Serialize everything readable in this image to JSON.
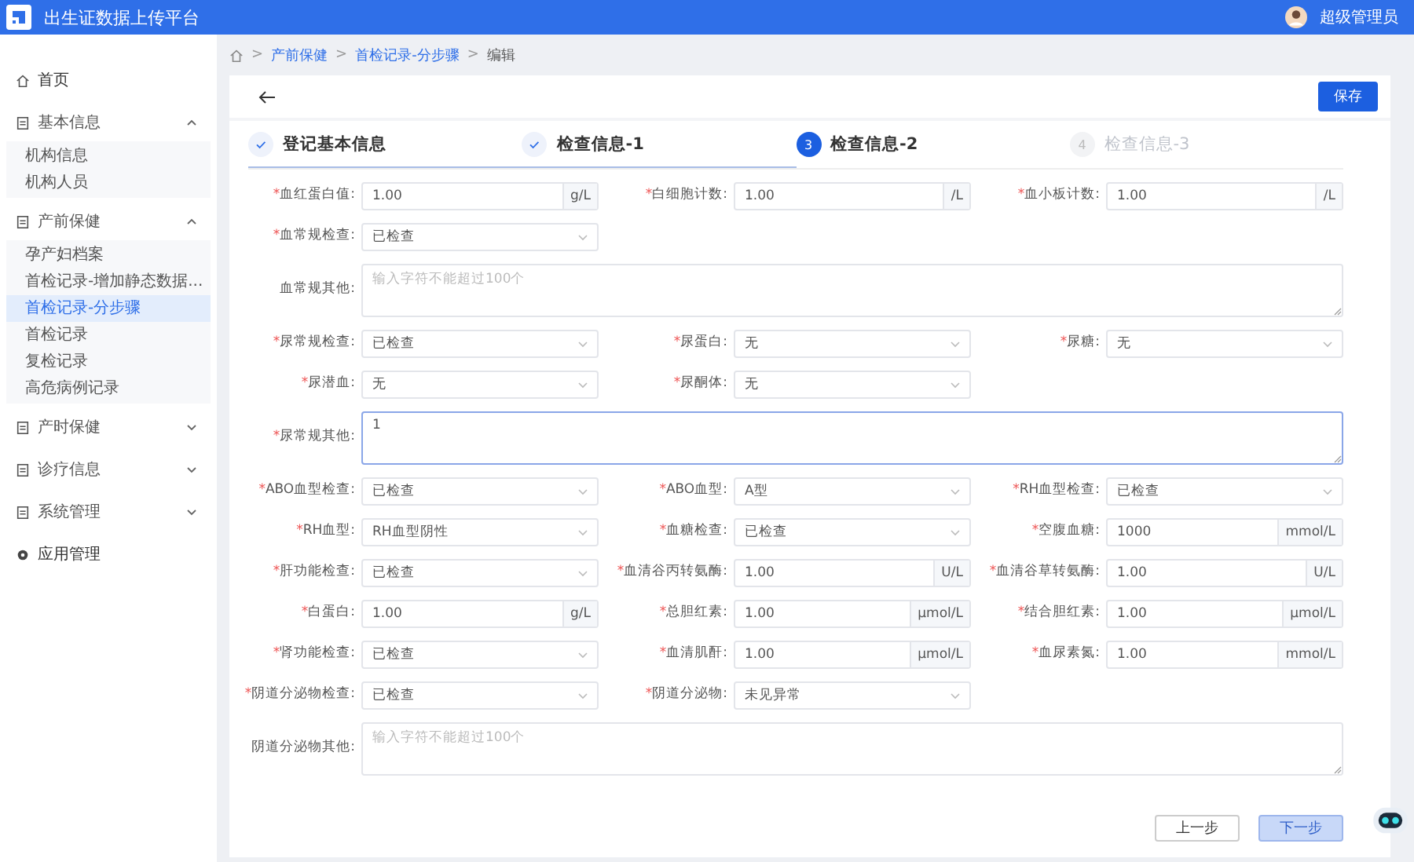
{
  "header": {
    "title": "出生证数据上传平台",
    "user": "超级管理员"
  },
  "sidebar": {
    "items": [
      {
        "label": "首页"
      },
      {
        "label": "基本信息",
        "expanded": true,
        "children": [
          {
            "label": "机构信息",
            "selected": false
          },
          {
            "label": "机构人员",
            "selected": false
          }
        ]
      },
      {
        "label": "产前保健",
        "expanded": true,
        "children": [
          {
            "label": "孕产妇档案",
            "selected": false
          },
          {
            "label": "首检记录-增加静态数据...",
            "selected": false
          },
          {
            "label": "首检记录-分步骤",
            "selected": true
          },
          {
            "label": "首检记录",
            "selected": false
          },
          {
            "label": "复检记录",
            "selected": false
          },
          {
            "label": "高危病例记录",
            "selected": false
          }
        ]
      },
      {
        "label": "产时保健",
        "expanded": false
      },
      {
        "label": "诊疗信息",
        "expanded": false
      },
      {
        "label": "系统管理",
        "expanded": false
      },
      {
        "label": "应用管理"
      }
    ]
  },
  "breadcrumb": [
    {
      "label": ">",
      "kind": "separator"
    },
    {
      "label": "产前保健",
      "kind": "link"
    },
    {
      "label": ">",
      "kind": "separator"
    },
    {
      "label": "首检记录-分步骤",
      "kind": "link"
    },
    {
      "label": ">",
      "kind": "separator"
    },
    {
      "label": "编辑",
      "kind": "current"
    }
  ],
  "toolbar": {
    "save": "保存"
  },
  "steps": [
    {
      "title": "登记基本信息",
      "completed": true,
      "selected": false
    },
    {
      "title": "检查信息-1",
      "completed": true,
      "selected": false
    },
    {
      "number": "3",
      "title": "检查信息-2",
      "completed": false,
      "selected": true
    },
    {
      "number": "4",
      "title": "检查信息-3",
      "completed": false,
      "selected": false
    }
  ],
  "form": {
    "rows": [
      [
        {
          "asterisk": "*",
          "label": "血红蛋白值:",
          "kind": "input",
          "value": "1.00",
          "unit": "g/L"
        },
        {
          "asterisk": "*",
          "label": "白细胞计数:",
          "kind": "input",
          "value": "1.00",
          "unit": "/L"
        },
        {
          "asterisk": "*",
          "label": "血小板计数:",
          "kind": "input",
          "value": "1.00",
          "unit": "/L"
        }
      ],
      [
        {
          "asterisk": "*",
          "label": "血常规检查:",
          "kind": "select",
          "value": "已检查"
        }
      ],
      [
        {
          "label": "血常规其他:",
          "kind": "textarea",
          "placeholder": "输入字符不能超过100个",
          "focused": false
        }
      ],
      [
        {
          "asterisk": "*",
          "label": "尿常规检查:",
          "kind": "select",
          "value": "已检查"
        },
        {
          "asterisk": "*",
          "label": "尿蛋白:",
          "kind": "select",
          "value": "无"
        },
        {
          "asterisk": "*",
          "label": "尿糖:",
          "kind": "select",
          "value": "无"
        }
      ],
      [
        {
          "asterisk": "*",
          "label": "尿潜血:",
          "kind": "select",
          "value": "无"
        },
        {
          "asterisk": "*",
          "label": "尿酮体:",
          "kind": "select",
          "value": "无"
        }
      ],
      [
        {
          "asterisk": "*",
          "label": "尿常规其他:",
          "kind": "textarea",
          "value": "1",
          "focused": true
        }
      ],
      [
        {
          "asterisk": "*",
          "label": "ABO血型检查:",
          "kind": "select",
          "value": "已检查"
        },
        {
          "asterisk": "*",
          "label": "ABO血型:",
          "kind": "select",
          "value": "A型"
        },
        {
          "asterisk": "*",
          "label": "RH血型检查:",
          "kind": "select",
          "value": "已检查"
        }
      ],
      [
        {
          "asterisk": "*",
          "label": "RH血型:",
          "kind": "select",
          "value": "RH血型阴性"
        },
        {
          "asterisk": "*",
          "label": "血糖检查:",
          "kind": "select",
          "value": "已检查"
        },
        {
          "asterisk": "*",
          "label": "空腹血糖:",
          "kind": "input",
          "value": "1000",
          "unit": "mmol/L"
        }
      ],
      [
        {
          "asterisk": "*",
          "label": "肝功能检查:",
          "kind": "select",
          "value": "已检查"
        },
        {
          "asterisk": "*",
          "label": "血清谷丙转氨酶:",
          "kind": "input",
          "value": "1.00",
          "unit": "U/L"
        },
        {
          "asterisk": "*",
          "label": "血清谷草转氨酶:",
          "kind": "input",
          "value": "1.00",
          "unit": "U/L"
        }
      ],
      [
        {
          "asterisk": "*",
          "label": "白蛋白:",
          "kind": "input",
          "value": "1.00",
          "unit": "g/L"
        },
        {
          "asterisk": "*",
          "label": "总胆红素:",
          "kind": "input",
          "value": "1.00",
          "unit": "μmol/L"
        },
        {
          "asterisk": "*",
          "label": "结合胆红素:",
          "kind": "input",
          "value": "1.00",
          "unit": "μmol/L"
        }
      ],
      [
        {
          "asterisk": "*",
          "label": "肾功能检查:",
          "kind": "select",
          "value": "已检查"
        },
        {
          "asterisk": "*",
          "label": "血清肌酐:",
          "kind": "input",
          "value": "1.00",
          "unit": "μmol/L"
        },
        {
          "asterisk": "*",
          "label": "血尿素氮:",
          "kind": "input",
          "value": "1.00",
          "unit": "mmol/L"
        }
      ],
      [
        {
          "asterisk": "*",
          "label": "阴道分泌物检查:",
          "kind": "select",
          "value": "已检查"
        },
        {
          "asterisk": "*",
          "label": "阴道分泌物:",
          "kind": "select",
          "value": "未见异常"
        }
      ],
      [
        {
          "label": "阴道分泌物其他:",
          "kind": "textarea",
          "placeholder": "输入字符不能超过100个",
          "focused": false
        }
      ]
    ]
  },
  "footer": {
    "prev": "上一步",
    "next": "下一步"
  }
}
